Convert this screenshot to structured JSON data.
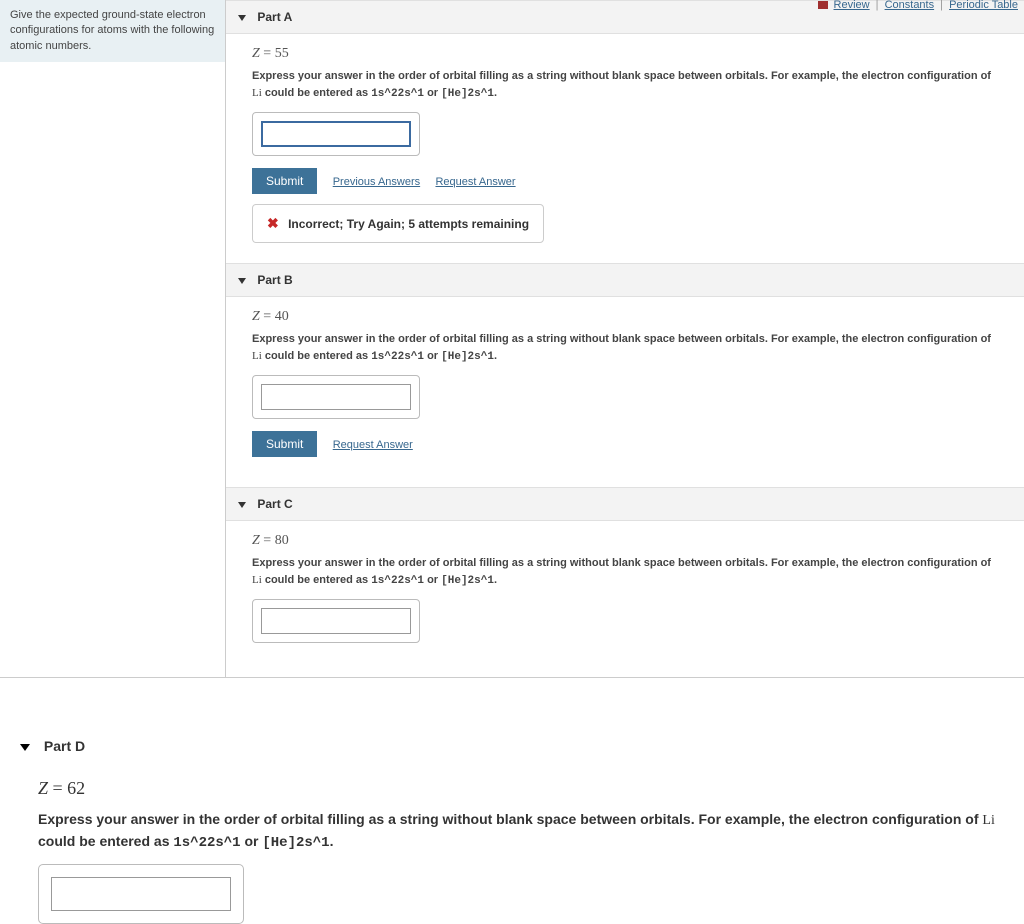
{
  "sidebar": {
    "prompt": "Give the expected ground-state electron configurations for atoms with the following atomic numbers."
  },
  "top_links": {
    "review": "Review",
    "constants": "Constants",
    "periodic": "Periodic Table"
  },
  "parts": {
    "a": {
      "title": "Part A",
      "z_label": "Z",
      "z_eq": " = ",
      "z_value": "55",
      "instr_prefix": "Express your answer in the order of orbital filling as a string without blank space between orbitals. For example, the electron configuration of ",
      "instr_li": "Li",
      "instr_middle": " could be entered as ",
      "instr_ex1": "1s^22s^1",
      "instr_or": " or ",
      "instr_ex2": "[He]2s^1",
      "instr_end": ".",
      "submit": "Submit",
      "prev_answers": "Previous Answers",
      "request_answer": "Request Answer",
      "feedback": "Incorrect; Try Again; 5 attempts remaining"
    },
    "b": {
      "title": "Part B",
      "z_value": "40",
      "instr_prefix": "Express your answer in the order of orbital filling as a string without blank space between orbitals. For example, the electron configuration of ",
      "instr_li": "Li",
      "instr_middle": " could be entered as ",
      "instr_ex1": "1s^22s^1",
      "instr_or": " or ",
      "instr_ex2": "[He]2s^1",
      "instr_end": ".",
      "submit": "Submit",
      "request_answer": "Request Answer"
    },
    "c": {
      "title": "Part C",
      "z_value": "80",
      "instr_prefix": "Express your answer in the order of orbital filling as a string without blank space between orbitals. For example, the electron configuration of ",
      "instr_li": "Li",
      "instr_middle": " could be entered as ",
      "instr_ex1": "1s^22s^1",
      "instr_or": " or ",
      "instr_ex2": "[He]2s^1",
      "instr_end": "."
    },
    "d": {
      "title": "Part D",
      "z_value": "62",
      "instr_prefix": "Express your answer in the order of orbital filling as a string without blank space between orbitals. For example, the electron configuration of ",
      "instr_li": "Li",
      "instr_middle": " could be entered as ",
      "instr_ex1": "1s^22s^1",
      "instr_or": " or ",
      "instr_ex2": "[He]2s^1",
      "instr_end": "."
    }
  }
}
